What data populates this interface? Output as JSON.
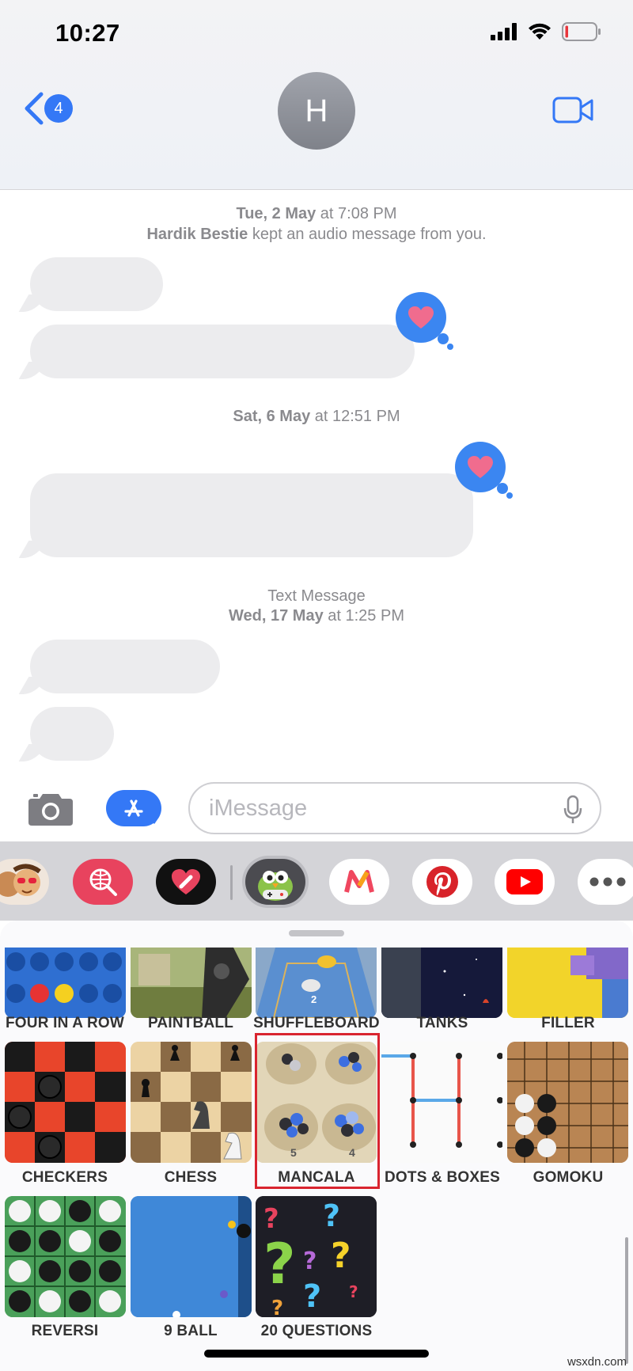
{
  "status_bar": {
    "time": "10:27"
  },
  "nav": {
    "back_count": "4",
    "contact_initial": "H"
  },
  "conversation": {
    "timestamp1": {
      "day": "Tue, 2 May",
      "time": " at 7:08 PM"
    },
    "system_note": {
      "name": "Hardik Bestie",
      "text": " kept an audio message from you."
    },
    "timestamp2": {
      "day": "Sat, 6 May",
      "time": " at 12:51 PM"
    },
    "timestamp3": {
      "service": "Text Message",
      "day": "Wed, 17 May",
      "time": " at 1:25 PM"
    },
    "tapback": "heart"
  },
  "input": {
    "placeholder": "iMessage"
  },
  "app_strip": {
    "items": [
      "memoji-stickers",
      "images-search",
      "digital-touch",
      "game-pigeon",
      "myntra",
      "pinterest",
      "youtube",
      "more"
    ]
  },
  "games": [
    {
      "label": "FOUR IN A ROW"
    },
    {
      "label": "PAINTBALL"
    },
    {
      "label": "SHUFFLEBOARD"
    },
    {
      "label": "TANKS"
    },
    {
      "label": "FILLER"
    },
    {
      "label": "CHECKERS"
    },
    {
      "label": "CHESS"
    },
    {
      "label": "MANCALA",
      "highlighted": true
    },
    {
      "label": "DOTS & BOXES"
    },
    {
      "label": "GOMOKU"
    },
    {
      "label": "REVERSI"
    },
    {
      "label": "9 BALL"
    },
    {
      "label": "20 QUESTIONS"
    }
  ],
  "mancala_tile_numbers": [
    "5",
    "4"
  ],
  "shuffleboard_tile_number": "2",
  "watermark": "wsxdn.com",
  "colors": {
    "accent": "#3478f6",
    "highlight": "#d9242f",
    "bubble": "#ececee",
    "tapback": "#3b86f1"
  }
}
